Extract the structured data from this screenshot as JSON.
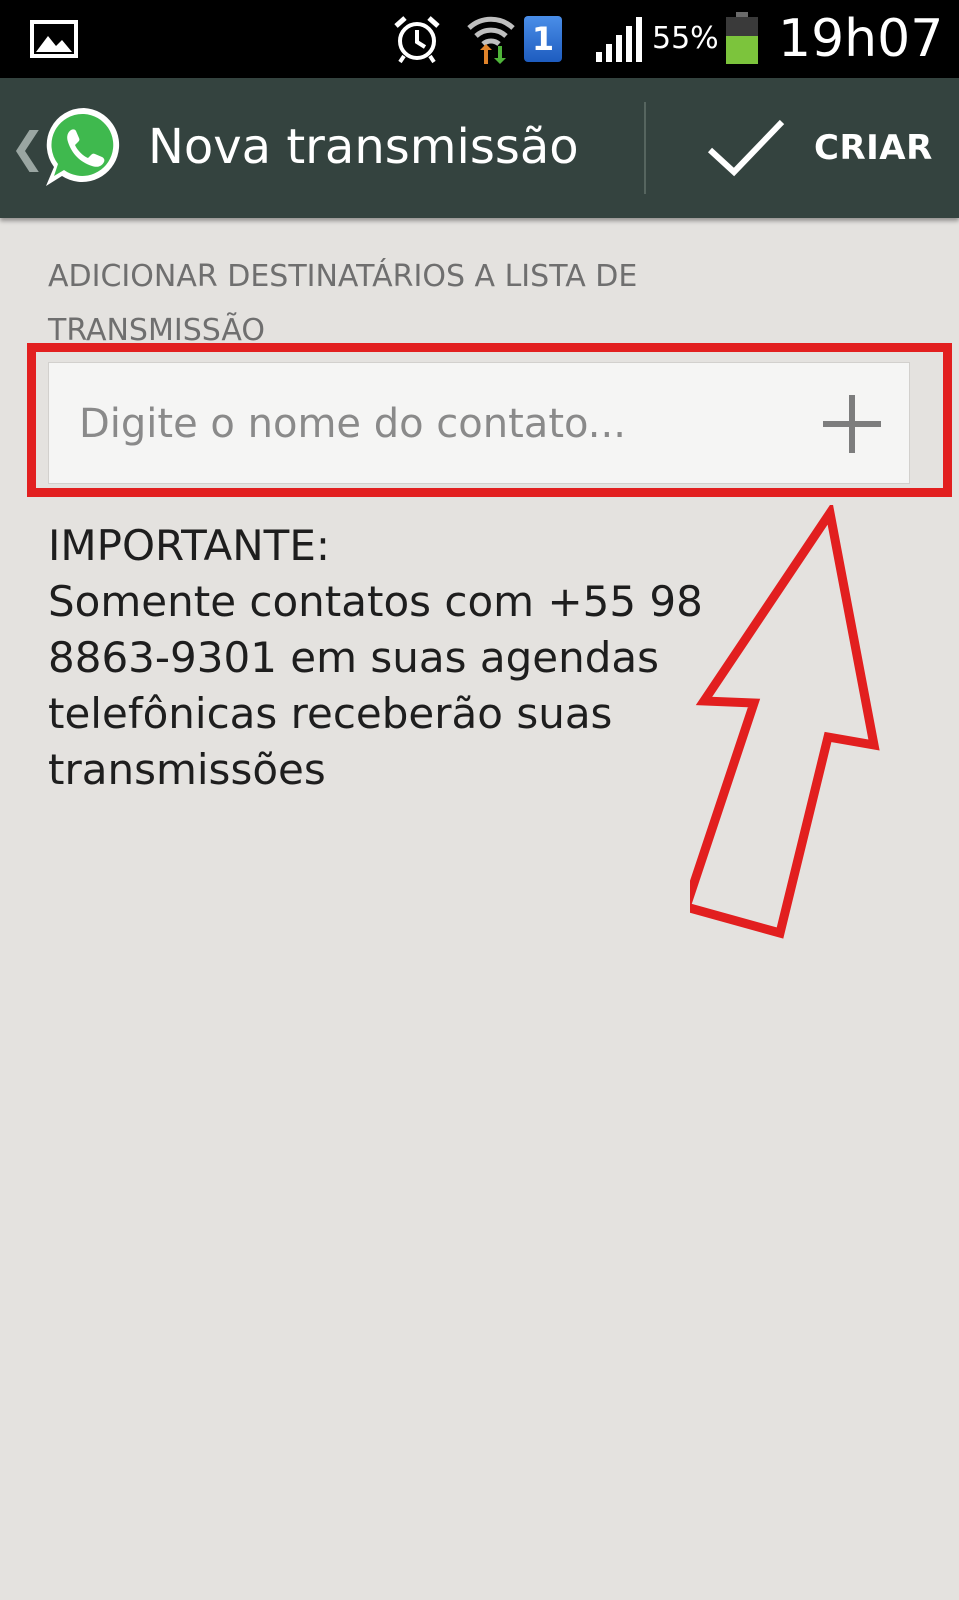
{
  "status_bar": {
    "notification_count": "1",
    "battery_percent": "55%",
    "time": "19h07",
    "icons": [
      "gallery-icon",
      "alarm-icon",
      "wifi-icon",
      "signal-icon",
      "battery-icon"
    ]
  },
  "action_bar": {
    "back_symbol": "❮",
    "title": "Nova transmissão",
    "create_label": "CRIAR"
  },
  "content": {
    "section_label_lines": [
      "ADICIONAR DESTINATÁRIOS A LISTA DE",
      "TRANSMISSÃO"
    ],
    "input_placeholder": "Digite o nome do contato...",
    "input_value": "",
    "important_lines": [
      "IMPORTANTE:",
      "Somente contatos com +55 98",
      "8863-9301 em suas agendas",
      "telefônicas receberão suas",
      "transmissões"
    ]
  },
  "colors": {
    "status_bar_bg": "#000000",
    "action_bar_bg": "#34433f",
    "page_bg": "#e4e2df",
    "annotation_red": "#e21f1f",
    "whatsapp_green": "#3fb94e"
  }
}
